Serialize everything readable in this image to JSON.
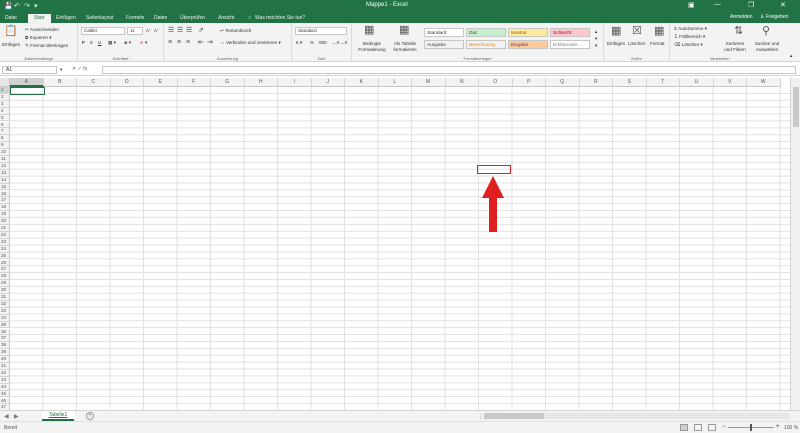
{
  "titlebar": {
    "doc_title": "Mappe1 - Excel",
    "sign_in": "Anmelden",
    "share": "Freigeben",
    "window_controls": [
      "minimize-icon",
      "restore-icon",
      "close-icon"
    ],
    "accent": "#217346"
  },
  "tabs": {
    "items": [
      "Datei",
      "Start",
      "Einfügen",
      "Seitenlayout",
      "Formeln",
      "Daten",
      "Überprüfen",
      "Ansicht"
    ],
    "active": "Start",
    "tell_me": "Was möchten Sie tun?"
  },
  "ribbon": {
    "clipboard": {
      "paste": "Einfügen",
      "cut": "Ausschneiden",
      "copy": "Kopieren",
      "format_painter": "Format übertragen",
      "label": "Zwischenablage"
    },
    "font": {
      "name": "Calibri",
      "size": "11",
      "label": "Schriftart"
    },
    "alignment": {
      "wrap_text": "Textumbruch",
      "merge": "Verbinden und zentrieren",
      "label": "Ausrichtung"
    },
    "number": {
      "format": "Standard",
      "label": "Zahl"
    },
    "styles": {
      "conditional": "Bedingte Formatierung",
      "as_table": "Als Tabelle formatieren",
      "cells": [
        {
          "label": "Standard",
          "bg": "#ffffff",
          "fg": "#333333"
        },
        {
          "label": "Gut",
          "bg": "#c6efce",
          "fg": "#006100"
        },
        {
          "label": "Neutral",
          "bg": "#ffeb9c",
          "fg": "#9c5700"
        },
        {
          "label": "Schlecht",
          "bg": "#ffc7ce",
          "fg": "#9c0006"
        },
        {
          "label": "Ausgabe",
          "bg": "#f2f2f2",
          "fg": "#3f3f3f"
        },
        {
          "label": "Berechnung",
          "bg": "#f2f2f2",
          "fg": "#fa7d00"
        },
        {
          "label": "Eingabe",
          "bg": "#ffcc99",
          "fg": "#3f3f76"
        },
        {
          "label": "Erklärender ...",
          "bg": "#ffffff",
          "fg": "#7f7f7f"
        }
      ],
      "label": "Formatvorlagen"
    },
    "cells": {
      "insert": "Einfügen",
      "delete": "Löschen",
      "format": "Format",
      "label": "Zellen"
    },
    "editing": {
      "autosum": "AutoSumme",
      "fill": "Füllbereich",
      "clear": "Löschen",
      "sort": "Sortieren und Filtern",
      "find": "Suchen und Auswählen",
      "label": "Bearbeiten"
    }
  },
  "formula_bar": {
    "name_box": "A1",
    "fx": "fx"
  },
  "grid": {
    "columns": [
      "A",
      "B",
      "C",
      "D",
      "E",
      "F",
      "G",
      "H",
      "I",
      "J",
      "K",
      "L",
      "M",
      "N",
      "O",
      "P",
      "Q",
      "R",
      "S",
      "T",
      "U",
      "V",
      "W"
    ],
    "rows": [
      1,
      2,
      3,
      4,
      5,
      6,
      7,
      8,
      9,
      10,
      11,
      12,
      13,
      14,
      15,
      16,
      17,
      18,
      19,
      20,
      21,
      22,
      23,
      24,
      25,
      26,
      27,
      28,
      29,
      30,
      31,
      32,
      33,
      34,
      35,
      36,
      37,
      38,
      39,
      40,
      41,
      42,
      43,
      44,
      45,
      46,
      47
    ],
    "selected_cell": "A1"
  },
  "annotation": {
    "highlight_color": "#e02020",
    "highlighted_cell": "O16"
  },
  "sheets": {
    "tabs": [
      "Tabelle1"
    ],
    "active": "Tabelle1"
  },
  "statusbar": {
    "status": "Bereit",
    "zoom": "100 %"
  }
}
